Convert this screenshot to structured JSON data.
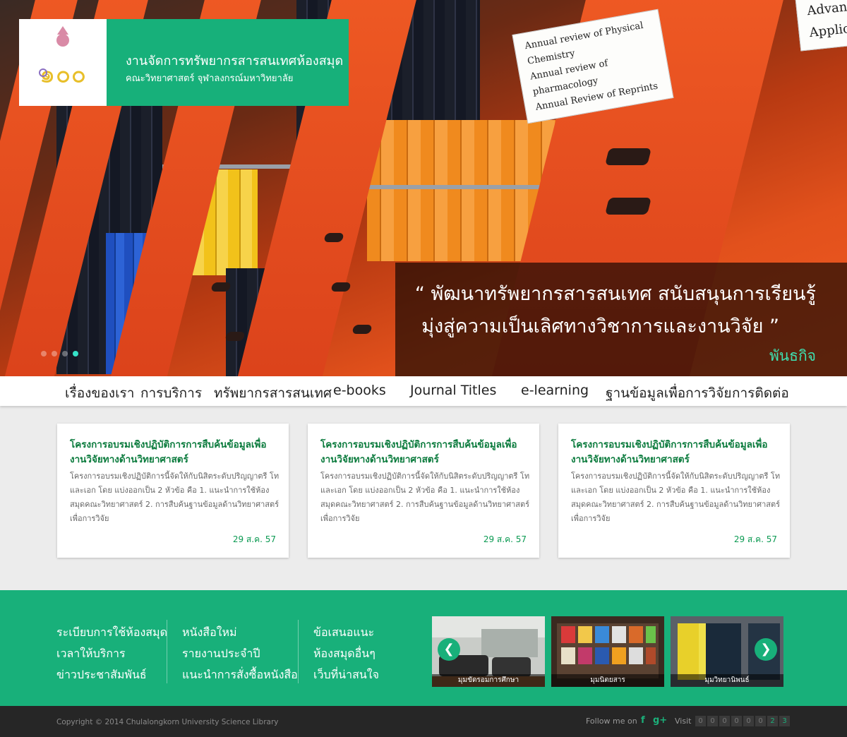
{
  "header": {
    "title_th": "งานจัดการทรัพยากรสารสนเทศห้องสมุด",
    "subtitle_th": "คณะวิทยาศาสตร์ จุฬาลงกรณ์มหาวิทยาลัย",
    "logo_text": "๑๐๐"
  },
  "hero": {
    "labels": [
      "Annual review of Physical Chemistry",
      "Annual review of pharmacology",
      "Annual Review of Reprints"
    ],
    "corner_labels": [
      "Advanc",
      "Applic"
    ],
    "mission_line1": "“ พัฒนาทรัพยากรสารสนเทศ สนับสนุนการเรียนรู้",
    "mission_line2": "มุ่งสู่ความเป็นเลิศทางวิชาการและงานวิจัย ”",
    "mission_label": "พันธกิจ",
    "slides": 4,
    "active_slide": 4
  },
  "nav": {
    "items": [
      "เรื่องของเรา",
      "การบริการ",
      "ทรัพยากรสารสนเทศ",
      "e-books",
      "Journal Titles",
      "e-learning",
      "ฐานข้อมูลเพื่อการวิจัย",
      "การติดต่อ"
    ]
  },
  "cards": [
    {
      "title": "โครงการอบรมเชิงปฏิบัติการการสืบค้นข้อมูลเพื่องานวิจัยทางด้านวิทยาศาสตร์",
      "body": "โครงการอบรมเชิงปฏิบัติการนี้จัดให้กับนิสิตระดับปริญญาตรี โท และเอก โดย แบ่งออกเป็น 2 หัวข้อ คือ 1. แนะนำการใช้ห้องสมุดคณะวิทยาศาสตร์ 2. การสืบค้นฐานข้อมูลด้านวิทยาศาสตร์ เพื่อการวิจัย",
      "date": "29 ส.ค. 57"
    },
    {
      "title": "โครงการอบรมเชิงปฏิบัติการการสืบค้นข้อมูลเพื่องานวิจัยทางด้านวิทยาศาสตร์",
      "body": "โครงการอบรมเชิงปฏิบัติการนี้จัดให้กับนิสิตระดับปริญญาตรี โท และเอก โดย แบ่งออกเป็น 2 หัวข้อ คือ 1. แนะนำการใช้ห้องสมุดคณะวิทยาศาสตร์ 2. การสืบค้นฐานข้อมูลด้านวิทยาศาสตร์ เพื่อการวิจัย",
      "date": "29 ส.ค. 57"
    },
    {
      "title": "โครงการอบรมเชิงปฏิบัติการการสืบค้นข้อมูลเพื่องานวิจัยทางด้านวิทยาศาสตร์",
      "body": "โครงการอบรมเชิงปฏิบัติการนี้จัดให้กับนิสิตระดับปริญญาตรี โท และเอก โดย แบ่งออกเป็น 2 หัวข้อ คือ 1. แนะนำการใช้ห้องสมุดคณะวิทยาศาสตร์ 2. การสืบค้นฐานข้อมูลด้านวิทยาศาสตร์ เพื่อการวิจัย",
      "date": "29 ส.ค. 57"
    }
  ],
  "footer": {
    "col1": [
      "ระเบียบการใช้ห้องสมุด",
      "เวลาให้บริการ",
      "ข่าวประชาสัมพันธ์"
    ],
    "col2": [
      "หนังสือใหม่",
      "รายงานประจำปี",
      "แนะนำการสั่งซื้อหนังสือ"
    ],
    "col3": [
      "ข้อเสนอแนะ",
      "ห้องสมุดอื่นๆ",
      "เว็บที่น่าสนใจ"
    ],
    "gallery": [
      "มุมขัดรอมการศึกษา",
      "มุมนิตยสาร",
      "มุมวิทยานิพนธ์"
    ],
    "prev_icon": "❮",
    "next_icon": "❯",
    "copyright": "Copyright © 2014 Chulalongkorn University Science Library",
    "follow_label": "Follow me on",
    "facebook_icon": "f",
    "gplus_icon": "g+",
    "visit_label": "Visit",
    "visit_digits": [
      "0",
      "0",
      "0",
      "0",
      "0",
      "0",
      "2",
      "3"
    ]
  },
  "colors": {
    "brand_green": "#18b07a",
    "title_green": "#0b7b3d",
    "dark_footer": "#262626"
  }
}
